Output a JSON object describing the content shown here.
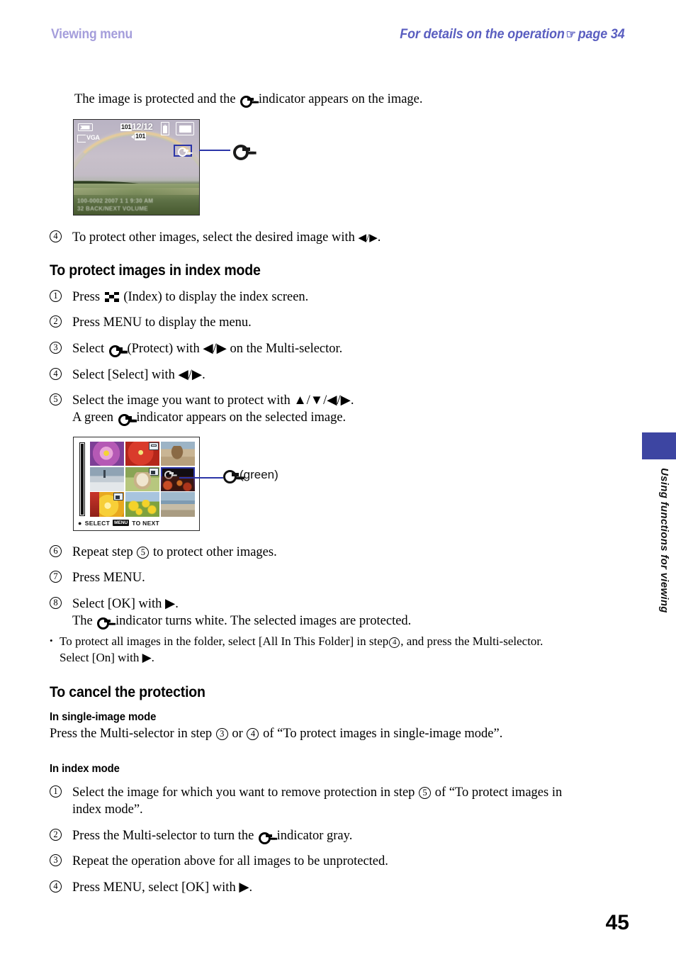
{
  "header": {
    "left_title": "Viewing menu",
    "right_title_before": "For details on the operation",
    "hand_icon": "☞",
    "right_title_after": "page 34"
  },
  "intro": {
    "before_icon": "The image is protected and the",
    "after_icon": "indicator appears on the image."
  },
  "single_image_figure": {
    "osd": {
      "quality_label": "VGA",
      "folder_number": "101",
      "folder_number_secondary": "101",
      "image_count": "12/12",
      "exif_line1": "100-0002      2007   1   1  9:30 AM",
      "exif_line2": "32 BACK/NEXT                   VOLUME"
    },
    "callout_label": "protect-key-indicator"
  },
  "step_after_figure": {
    "number": "4",
    "text_before": "To protect other images, select the desired image with",
    "arrows": "◀/▶",
    "text_after": "."
  },
  "section_index_mode": {
    "heading": "To protect images in index mode",
    "steps": [
      {
        "number": "1",
        "pre": "Press",
        "icon": "index-icon",
        "post": "(Index) to display the index screen."
      },
      {
        "number": "2",
        "pre": "Press MENU to display the menu.",
        "icon": "",
        "post": ""
      },
      {
        "number": "3",
        "pre": "Select",
        "icon": "key-icon",
        "post": "(Protect) with ◀/▶ on the Multi-selector."
      },
      {
        "number": "4",
        "pre": "Select [Select] with ◀/▶.",
        "icon": "",
        "post": ""
      },
      {
        "number": "5",
        "pre": "Select the image you want to protect with ▲/▼/◀/▶.",
        "icon": "",
        "post": "",
        "sub_before": "A green",
        "sub_after": "indicator appears on the selected image."
      }
    ]
  },
  "index_figure": {
    "select_label": "SELECT",
    "to_next_label": "TO NEXT",
    "menu_key_label": "MENU",
    "callout_text": "(green)",
    "thumbnails": [
      {
        "name": "purple-lotus",
        "badge": ""
      },
      {
        "name": "red-flower",
        "badge": "print"
      },
      {
        "name": "dog-on-beach",
        "badge": ""
      },
      {
        "name": "snow-landscape",
        "badge": ""
      },
      {
        "name": "cat",
        "badge": "cam"
      },
      {
        "name": "night-festival",
        "badge": "selected"
      },
      {
        "name": "yellow-rose",
        "badge": "cam"
      },
      {
        "name": "sunflowers",
        "badge": ""
      },
      {
        "name": "seashore",
        "badge": ""
      }
    ]
  },
  "steps_continued": [
    {
      "number": "6",
      "pre": "Repeat step",
      "inline_circle": "5",
      "post": "to protect other images."
    },
    {
      "number": "7",
      "pre": "Press MENU.",
      "inline_circle": "",
      "post": ""
    },
    {
      "number": "8",
      "pre": "Select [OK] with ▶.",
      "inline_circle": "",
      "post": "",
      "sub_before": "The",
      "sub_after": "indicator turns white. The selected images are protected."
    }
  ],
  "note_bullet": {
    "bullet": "•",
    "line1_pre": "To protect all images in the folder, select [All In This Folder] in step",
    "line1_circle": "4",
    "line1_post": ", and press the Multi-selector.",
    "line2": "Select [On] with ▶."
  },
  "section_cancel": {
    "heading": "To cancel the protection",
    "single_image": {
      "sub_heading": "In single-image mode",
      "text_pre": "Press the Multi-selector in step",
      "circle1": "3",
      "text_mid": "or",
      "circle2": "4",
      "text_post": "of “To protect images in single-image mode”."
    },
    "index_mode": {
      "sub_heading": "In index mode",
      "steps": [
        {
          "number": "1",
          "pre": "Select the image for which you want to remove protection in step",
          "inline_circle": "5",
          "post": "of “To protect images in",
          "line2": "index mode”."
        },
        {
          "number": "2",
          "pre": "Press the Multi-selector to turn the",
          "inline_circle": "",
          "post": "indicator gray.",
          "has_key_icon": true
        },
        {
          "number": "3",
          "pre": "Repeat the operation above for all images to be unprotected.",
          "inline_circle": "",
          "post": ""
        },
        {
          "number": "4",
          "pre": "Press MENU, select [OK] with ▶.",
          "inline_circle": "",
          "post": ""
        }
      ]
    }
  },
  "side_tab": {
    "label": "Using functions for viewing",
    "color": "#3d45a2"
  },
  "page_number": "45",
  "colors": {
    "header_left": "#a49ddb",
    "header_right": "#5a5ec0",
    "callout_blue": "#2b35a8",
    "green_indicator": "#1aa033"
  }
}
